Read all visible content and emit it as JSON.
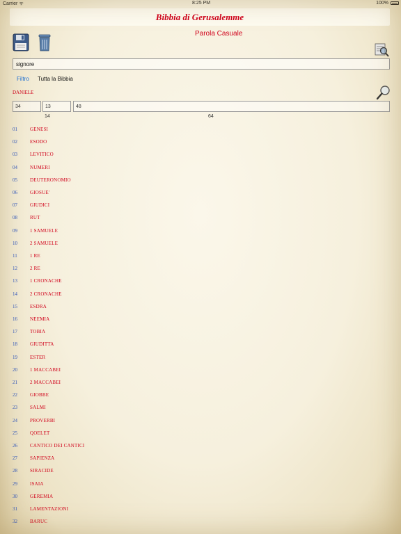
{
  "status_bar": {
    "carrier": "Carrier ᯤ",
    "time": "8:25 PM",
    "battery": "100%"
  },
  "title": "Bibbia di Gerusalemme",
  "random_word_label": "Parola Casuale",
  "search": {
    "value": "signore"
  },
  "filter": {
    "label": "Filtro",
    "scope": "Tutta la Bibbia"
  },
  "current_book": "DANIELE",
  "fields": {
    "book": "34",
    "chapter": "13",
    "verse": "48"
  },
  "counts": {
    "chapters": "14",
    "verses": "64"
  },
  "books": [
    {
      "num": "01",
      "name": "GENESI"
    },
    {
      "num": "02",
      "name": "ESODO"
    },
    {
      "num": "03",
      "name": "LEVITICO"
    },
    {
      "num": "04",
      "name": "NUMERI"
    },
    {
      "num": "05",
      "name": "DEUTERONOMIO"
    },
    {
      "num": "06",
      "name": "GIOSUE'"
    },
    {
      "num": "07",
      "name": "GIUDICI"
    },
    {
      "num": "08",
      "name": "RUT"
    },
    {
      "num": "09",
      "name": "1 SAMUELE"
    },
    {
      "num": "10",
      "name": "2 SAMUELE"
    },
    {
      "num": "11",
      "name": "1 RE"
    },
    {
      "num": "12",
      "name": "2 RE"
    },
    {
      "num": "13",
      "name": "1 CRONACHE"
    },
    {
      "num": "14",
      "name": "2 CRONACHE"
    },
    {
      "num": "15",
      "name": "ESDRA"
    },
    {
      "num": "16",
      "name": "NEEMIA"
    },
    {
      "num": "17",
      "name": "TOBIA"
    },
    {
      "num": "18",
      "name": "GIUDITTA"
    },
    {
      "num": "19",
      "name": "ESTER"
    },
    {
      "num": "20",
      "name": "1 MACCABEI"
    },
    {
      "num": "21",
      "name": "2 MACCABEI"
    },
    {
      "num": "22",
      "name": "GIOBBE"
    },
    {
      "num": "23",
      "name": "SALMI"
    },
    {
      "num": "24",
      "name": "PROVERBI"
    },
    {
      "num": "25",
      "name": "QOELET"
    },
    {
      "num": "26",
      "name": "CANTICO DEI CANTICI"
    },
    {
      "num": "27",
      "name": "SAPIENZA"
    },
    {
      "num": "28",
      "name": "SIRACIDE"
    },
    {
      "num": "29",
      "name": "ISAIA"
    },
    {
      "num": "30",
      "name": "GEREMIA"
    },
    {
      "num": "31",
      "name": "LAMENTAZIONI"
    },
    {
      "num": "32",
      "name": "BARUC"
    }
  ]
}
